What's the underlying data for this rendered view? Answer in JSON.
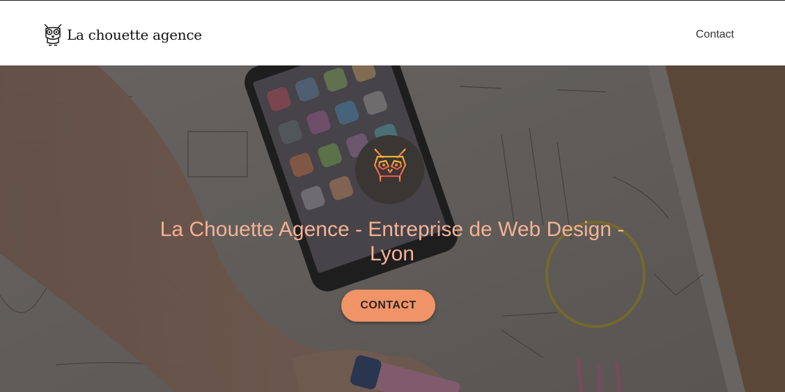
{
  "header": {
    "logo_text": "La chouette agence",
    "nav_contact": "Contact"
  },
  "hero": {
    "title": "La Chouette Agence - Entreprise de Web Design - Lyon",
    "cta_label": "CONTACT",
    "badge_icon": "owl-icon",
    "background_icon": "phone-on-sketch-paper-photo"
  },
  "colors": {
    "title": "#f4b293",
    "cta_background": "#f09467",
    "badge_background": "#3a3634",
    "owl_gradient_start": "#f7b733",
    "owl_gradient_end": "#e8504f"
  }
}
